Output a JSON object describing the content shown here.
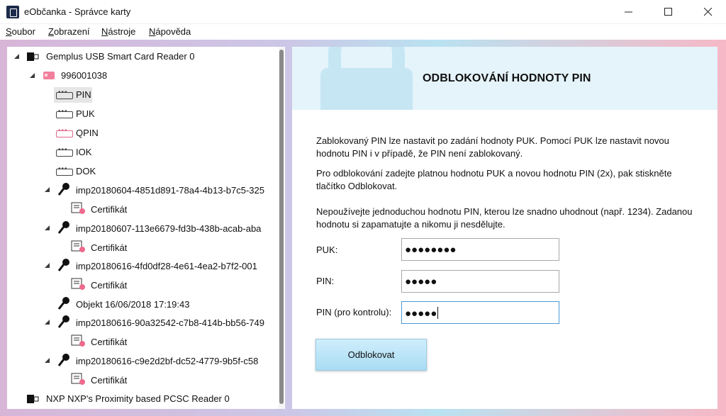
{
  "window": {
    "title": "eObčanka - Správce karty"
  },
  "menu": [
    {
      "label": "Soubor",
      "access": "S"
    },
    {
      "label": "Zobrazení",
      "access": "Z"
    },
    {
      "label": "Nástroje",
      "access": "N"
    },
    {
      "label": "Nápověda",
      "access": "N"
    }
  ],
  "tree": {
    "reader1": "Gemplus USB Smart Card Reader 0",
    "card": "996001038",
    "pins": [
      "PIN",
      "PUK",
      "QPIN",
      "IOK",
      "DOK"
    ],
    "keys": [
      {
        "label": "imp20180604-4851d891-78a4-4b13-b7c5-325",
        "cert": "Certifikát"
      },
      {
        "label": "imp20180607-113e6679-fd3b-438b-acab-aba",
        "cert": "Certifikát"
      },
      {
        "label": "imp20180616-4fd0df28-4e61-4ea2-b7f2-001",
        "cert": "Certifikát"
      },
      {
        "label": "Objekt 16/06/2018 17:19:43",
        "cert": ""
      },
      {
        "label": "imp20180616-90a32542-c7b8-414b-bb56-749",
        "cert": "Certifikát"
      },
      {
        "label": "imp20180616-c9e2d2bf-dc52-4779-9b5f-c58",
        "cert": "Certifikát"
      }
    ],
    "reader2": "NXP NXP's Proximity based PCSC Reader 0"
  },
  "panel": {
    "title": "ODBLOKOVÁNÍ HODNOTY PIN",
    "para1": "Zablokovaný PIN lze nastavit po zadání hodnoty PUK. Pomocí PUK lze nastavit novou hodnotu PIN i v případě, že PIN není zablokovaný.",
    "para2": "Pro odblokování zadejte platnou hodnotu PUK a novou hodnotu PIN (2x), pak stiskněte tlačítko Odblokovat.",
    "para3": "Nepoužívejte jednoduchou hodnotu PIN, kterou lze snadno uhodnout (např. 1234). Zadanou hodnotu si zapamatujte a nikomu ji nesdělujte.",
    "puk_label": "PUK:",
    "puk_value": "●●●●●●●●",
    "pin_label": "PIN:",
    "pin_value": "●●●●●",
    "pin2_label": "PIN (pro kontrolu):",
    "pin2_value": "●●●●●",
    "button": "Odblokovat"
  },
  "colors": {
    "header_band": "#e5f4fb",
    "button": "#a9dcf3",
    "card_icon": "#f27f9c",
    "focus_border": "#4a9ad6"
  }
}
